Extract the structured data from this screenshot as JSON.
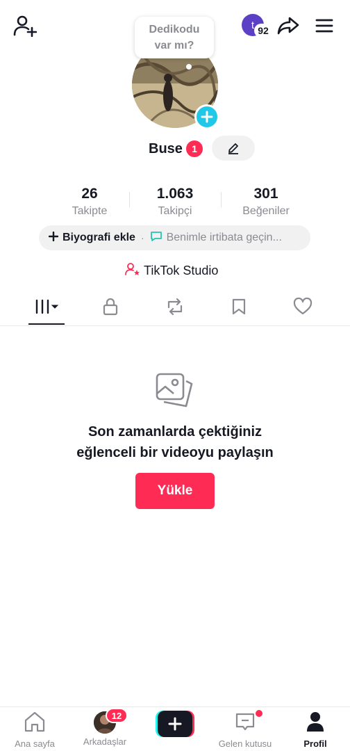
{
  "colors": {
    "accent": "#fe2c55",
    "cyan": "#25f4ee",
    "text": "#161823",
    "muted": "#8a8b91",
    "plus_badge": "#20c7e6",
    "mini_avatar": "#5b3fc4"
  },
  "header": {
    "mini_avatar_letter": "t",
    "notification_count": "92",
    "icons": [
      "add-friend-icon",
      "share-icon",
      "menu-icon"
    ]
  },
  "profile": {
    "bubble_line1": "Dedikodu",
    "bubble_line2": "var mı?",
    "name": "Buse",
    "name_badge": "1"
  },
  "stats": [
    {
      "value": "26",
      "label": "Takipte"
    },
    {
      "value": "1.063",
      "label": "Takipçi"
    },
    {
      "value": "301",
      "label": "Beğeniler"
    }
  ],
  "bio": {
    "add_label": "Biyografi ekle",
    "separator": "·",
    "message_label": "Benimle irtibata geçin..."
  },
  "studio": {
    "label": "TikTok Studio"
  },
  "tabs": [
    {
      "icon": "grid-icon",
      "active": true
    },
    {
      "icon": "lock-icon",
      "active": false
    },
    {
      "icon": "repost-icon",
      "active": false
    },
    {
      "icon": "bookmark-icon",
      "active": false
    },
    {
      "icon": "heart-icon",
      "active": false
    }
  ],
  "empty_state": {
    "line1": "Son zamanlarda çektiğiniz",
    "line2": "eğlenceli bir videoyu paylaşın",
    "button": "Yükle"
  },
  "nav": {
    "home": "Ana sayfa",
    "friends": "Arkadaşlar",
    "friends_badge": "12",
    "inbox": "Gelen kutusu",
    "profile": "Profil"
  }
}
